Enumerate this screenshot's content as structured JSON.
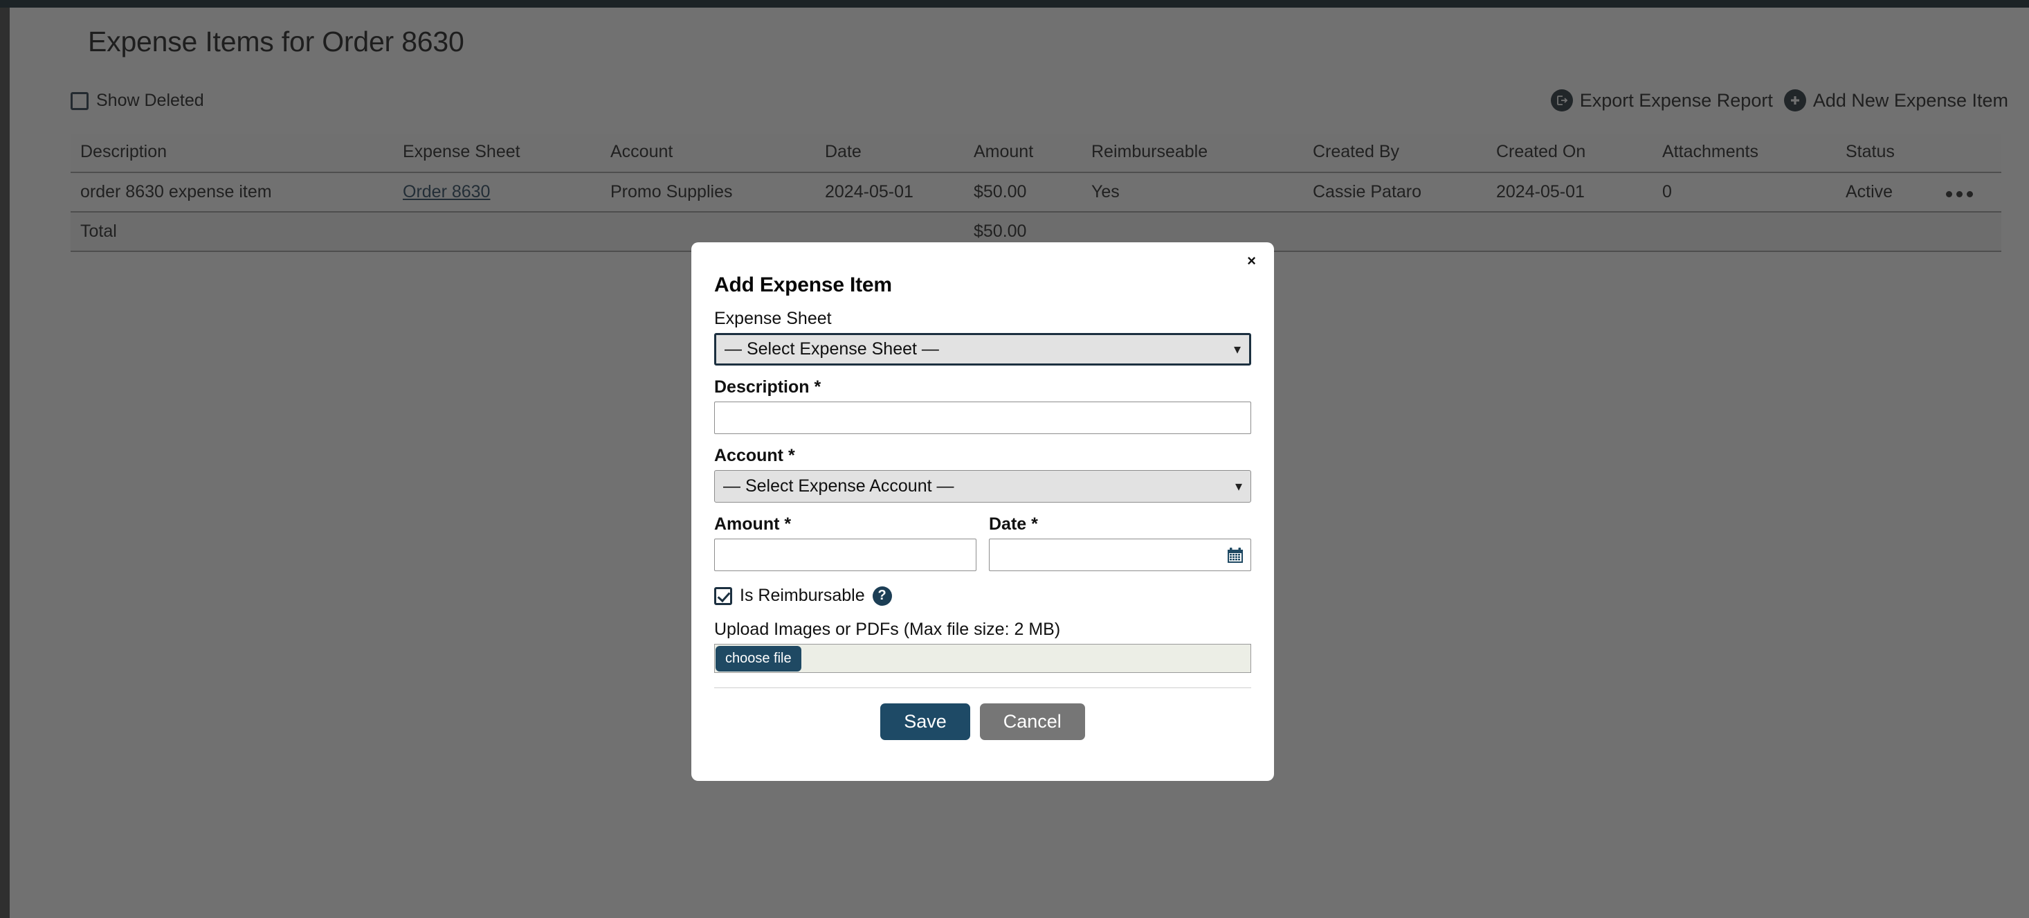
{
  "page": {
    "title": "Expense Items for Order 8630",
    "show_deleted_label": "Show Deleted"
  },
  "toolbar": {
    "export_label": "Export Expense Report",
    "export_icon": "export-circle-icon",
    "add_label": "Add New Expense Item",
    "add_icon": "plus-circle-icon"
  },
  "table": {
    "columns": [
      "Description",
      "Expense Sheet",
      "Account",
      "Date",
      "Amount",
      "Reimburseable",
      "Created By",
      "Created On",
      "Attachments",
      "Status"
    ],
    "rows": [
      {
        "description": "order 8630 expense item",
        "expense_sheet": "Order 8630",
        "account": "Promo Supplies",
        "date": "2024-05-01",
        "amount": "$50.00",
        "reimburseable": "Yes",
        "created_by": "Cassie Pataro",
        "created_on": "2024-05-01",
        "attachments": "0",
        "status": "Active",
        "actions_icon": "kebab-menu-icon"
      }
    ],
    "total_row": {
      "label": "Total",
      "amount": "$50.00"
    }
  },
  "modal": {
    "title": "Add Expense Item",
    "close_label": "×",
    "expense_sheet": {
      "label": "Expense Sheet",
      "value": "— Select Expense Sheet —"
    },
    "description": {
      "label": "Description *",
      "value": "",
      "placeholder": ""
    },
    "account": {
      "label": "Account *",
      "value": "— Select Expense Account —"
    },
    "amount": {
      "label": "Amount *",
      "value": "",
      "placeholder": ""
    },
    "date": {
      "label": "Date *",
      "value": "",
      "placeholder": "",
      "icon": "calendar-icon"
    },
    "reimbursable": {
      "label": "Is Reimbursable",
      "checked": true,
      "help_icon": "question-mark-circle-icon"
    },
    "upload": {
      "label": "Upload Images or PDFs (Max file size: 2 MB)",
      "button_label": "choose file",
      "filename": ""
    },
    "save_label": "Save",
    "cancel_label": "Cancel"
  },
  "colors": {
    "brand_navy": "#1c3040",
    "save_button": "#1e4a66",
    "cancel_button": "#767676",
    "link": "#1a3a52",
    "topbar": "#081c25"
  }
}
